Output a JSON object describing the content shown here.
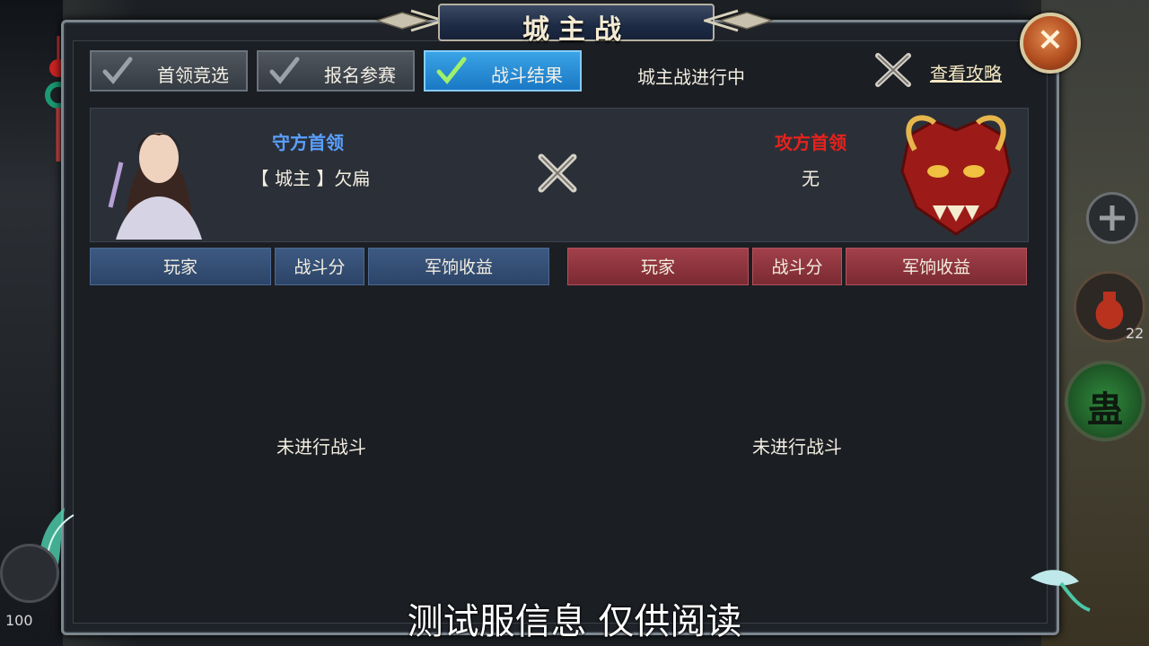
{
  "window": {
    "title": "城主战",
    "close_icon": "×"
  },
  "tabs": [
    {
      "label": "首领竞选",
      "active": false
    },
    {
      "label": "报名参赛",
      "active": false
    },
    {
      "label": "战斗结果",
      "active": true
    }
  ],
  "status": "城主战进行中",
  "guide_link": "查看攻略",
  "defender": {
    "label": "守方首领",
    "name": "【 城主 】欠扁",
    "label_color": "#5aa0ff"
  },
  "attacker": {
    "label": "攻方首领",
    "name": "无",
    "label_color": "#e8221c"
  },
  "defender_table": {
    "headers": [
      "玩家",
      "战斗分",
      "军饷收益"
    ],
    "empty_text": "未进行战斗"
  },
  "attacker_table": {
    "headers": [
      "玩家",
      "战斗分",
      "军饷收益"
    ],
    "empty_text": "未进行战斗"
  },
  "side_ui": {
    "potion_count": "22",
    "gu_label": "蛊",
    "level_text": "100"
  },
  "watermark": "测试服信息 仅供阅读"
}
